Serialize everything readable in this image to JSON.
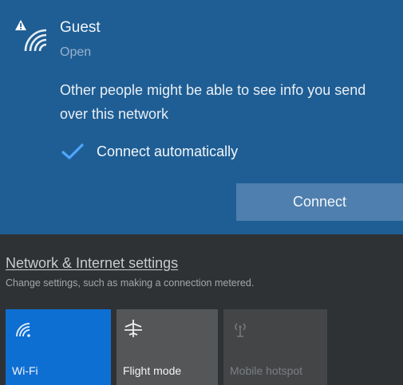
{
  "network": {
    "name": "Guest",
    "status": "Open",
    "warning": "Other people might be able to see info you send over this network",
    "connect_automatically": {
      "label": "Connect automatically",
      "checked": true
    },
    "connect_button": "Connect"
  },
  "settings": {
    "link": "Network & Internet settings",
    "description": "Change settings, such as making a connection metered."
  },
  "quick_actions": [
    {
      "label": "Wi-Fi",
      "icon": "wifi-icon",
      "state": "on"
    },
    {
      "label": "Flight mode",
      "icon": "airplane-icon",
      "state": "off"
    },
    {
      "label": "Mobile hotspot",
      "icon": "hotspot-icon",
      "state": "disabled"
    }
  ],
  "colors": {
    "card_background": "#1f5e94",
    "accent": "#0e6fd3",
    "connect_button": "#4f7fae",
    "panel_background": "#2f3234"
  }
}
